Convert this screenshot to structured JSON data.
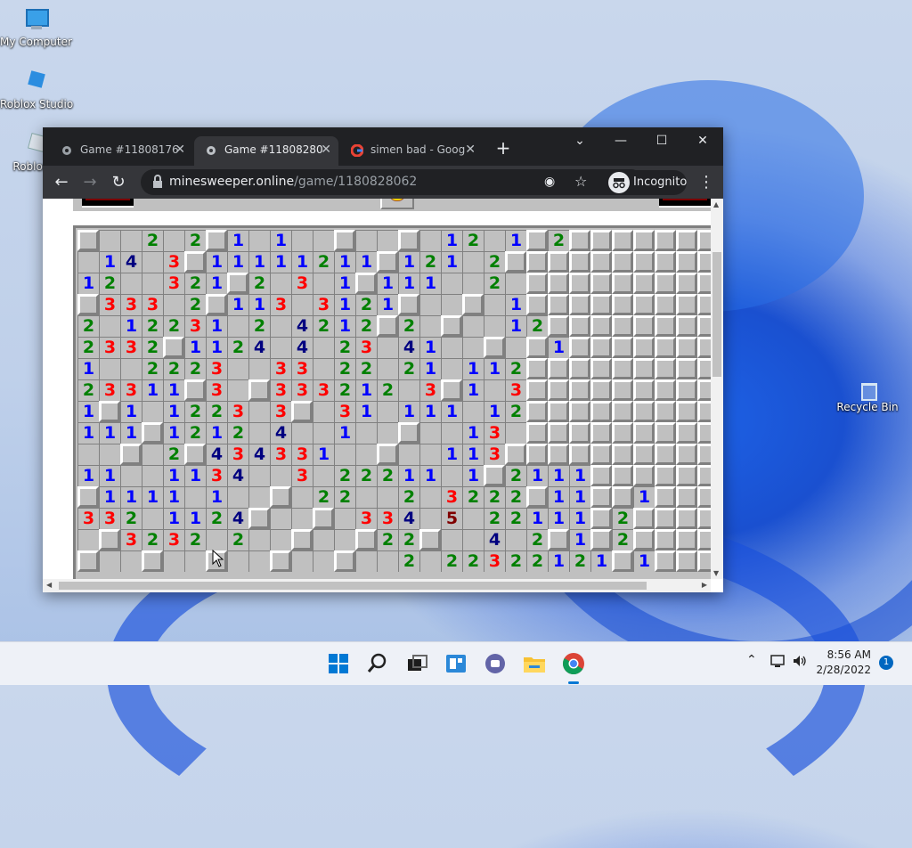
{
  "desktop": {
    "icons": [
      {
        "label": "My Computer",
        "icon": "computer-icon"
      },
      {
        "label": "Roblox Studio",
        "icon": "roblox-studio-icon"
      },
      {
        "label": "Roblox P",
        "icon": "roblox-player-icon"
      },
      {
        "label": "Recycle Bin",
        "icon": "recycle-bin-icon"
      }
    ],
    "wallpaper_accent": "#1a50d0"
  },
  "browser": {
    "tabs": [
      {
        "title": "Game #11808176",
        "icon": "minesweeper-icon",
        "active": false
      },
      {
        "title": "Game #11808280",
        "icon": "minesweeper-icon",
        "active": true
      },
      {
        "title": "simen bad - Goog",
        "icon": "google-icon",
        "active": false
      }
    ],
    "new_tab": "+",
    "url_host": "minesweeper.online",
    "url_path": "/game/1180828062",
    "incognito_label": "Incognito",
    "colors": {
      "tabbar": "#202124",
      "toolbar": "#35363a"
    }
  },
  "game": {
    "board": [
      "...2.2.1.1.......12.1.2..........",
      ".14.3.11111211.121.2.............",
      "12..321.2.3.1.111..2.............",
      ".333.2.113.3121.....1............",
      "2.12231.2.4212.2....12...........",
      "2332.1124.4.23.41.....1..........",
      "1..2223..33.22.21.112............",
      "23311.3..333212.3.1.3............",
      "1.1.1223.3..31.111.12............",
      "111.1212.4..1.....13.............",
      "....2.434331.....113.............",
      "11..1134..3.22211.1.2111.........",
      ".1111.1....22..2.3222.11..1......",
      "332.1124.....334.5.22111.2.......",
      "..3232.2......22...4.2.1.2.......",
      "...............2.22322121.1......"
    ],
    "number_colors": {
      "1": "#0000ff",
      "2": "#008000",
      "3": "#ff0000",
      "4": "#000080",
      "5": "#800000"
    }
  },
  "taskbar": {
    "apps": [
      "windows-start-icon",
      "search-icon",
      "task-view-icon",
      "widgets-icon",
      "teams-chat-icon",
      "file-explorer-icon",
      "chrome-icon"
    ],
    "time": "8:56 AM",
    "date": "2/28/2022",
    "notification_count": "1"
  }
}
